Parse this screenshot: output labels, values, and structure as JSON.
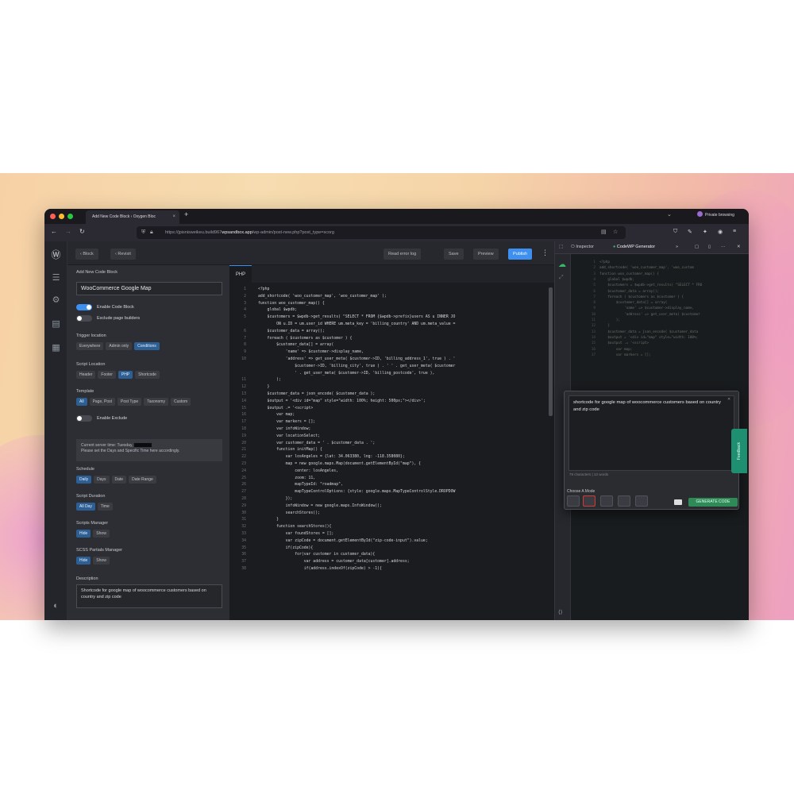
{
  "browser": {
    "tab_title": "Add New Code Block ‹ Oxygen Bloc",
    "new_tab": "+",
    "private_label": "Private browsing",
    "url_prefix": "https://jpisnisweikeu.build967",
    "url_domain": "wpsandbox.app",
    "url_path": "/wp-admin/post-new.php?post_type=scorg"
  },
  "toolbar": {
    "back_label": "‹ Block",
    "revisions_label": "‹ Revisit",
    "error_log_label": "Read error log",
    "save_label": "Save",
    "preview_label": "Preview",
    "publish_label": "Publish"
  },
  "settings": {
    "heading": "Add New Code Block",
    "title_value": "WooCommerce Google Map",
    "enable_code_block": "Enable Code Block",
    "exclude_page_builders": "Exclude page builders",
    "trigger_location_label": "Trigger location",
    "trigger_location_options": [
      "Everywhere",
      "Admin only",
      "Conditions"
    ],
    "script_location_label": "Script Location",
    "script_location_options": [
      "Header",
      "Footer",
      "PHP",
      "Shortcode"
    ],
    "template_label": "Template",
    "template_options": [
      "All",
      "Page, Post",
      "Post Type",
      "Taxonomy",
      "Custom"
    ],
    "enable_exclude": "Enable Exclude",
    "notice_line1": "Current server time: Tuesday,",
    "notice_line2": "Please set the Days and Specific Time here accordingly.",
    "schedule_label": "Schedule",
    "schedule_options": [
      "Daily",
      "Days",
      "Date",
      "Date Range"
    ],
    "script_duration_label": "Script Duration",
    "script_duration_options": [
      "All Day",
      "Time"
    ],
    "scripts_manager_label": "Scripts Manager",
    "scripts_manager_options": [
      "Hide",
      "Show"
    ],
    "scss_partials_label": "SCSS Partials Manager",
    "scss_partials_options": [
      "Hide",
      "Show"
    ],
    "description_label": "Description",
    "description_value": "Shortcode for google map of woocommerce customers based on country and zip code"
  },
  "editor": {
    "tab_label": "PHP",
    "lines": [
      {
        "n": "1",
        "t": "<?php"
      },
      {
        "n": "2",
        "t": "add_shortcode( 'woo_customer_map', 'woo_customer_map' );"
      },
      {
        "n": "3",
        "t": "function woo_customer_map() {"
      },
      {
        "n": "4",
        "t": "    global $wpdb;"
      },
      {
        "n": "5",
        "t": "    $customers = $wpdb->get_results( \"SELECT * FROM {$wpdb->prefix}users AS u INNER JO"
      },
      {
        "n": "",
        "t": "        ON u.ID = um.user_id WHERE um.meta_key = 'billing_country' AND um.meta_value ="
      },
      {
        "n": "6",
        "t": "    $customer_data = array();"
      },
      {
        "n": "7",
        "t": "    foreach ( $customers as $customer ) {"
      },
      {
        "n": "8",
        "t": "        $customer_data[] = array("
      },
      {
        "n": "9",
        "t": "            'name' => $customer->display_name,"
      },
      {
        "n": "10",
        "t": "            'address' => get_user_meta( $customer->ID, 'billing_address_1', true ) . '"
      },
      {
        "n": "",
        "t": "                $customer->ID, 'billing_city', true ) . ' ' . get_user_meta( $customer"
      },
      {
        "n": "",
        "t": "                ' . get_user_meta( $customer->ID, 'billing_postcode', true ),"
      },
      {
        "n": "11",
        "t": "        );"
      },
      {
        "n": "12",
        "t": "    }"
      },
      {
        "n": "13",
        "t": "    $customer_data = json_encode( $customer_data );"
      },
      {
        "n": "14",
        "t": "    $output = '<div id=\"map\" style=\"width: 100%; height: 500px;\"></div>';"
      },
      {
        "n": "15",
        "t": "    $output .= '<script>"
      },
      {
        "n": "16",
        "t": "        var map;"
      },
      {
        "n": "17",
        "t": "        var markers = [];"
      },
      {
        "n": "18",
        "t": "        var infoWindow;"
      },
      {
        "n": "19",
        "t": "        var locationSelect;"
      },
      {
        "n": "20",
        "t": "        var customer_data = ' . $customer_data . ';"
      },
      {
        "n": "21",
        "t": "        function initMap() {"
      },
      {
        "n": "22",
        "t": "            var losAngeles = {lat: 34.063380, lng: -118.358080};"
      },
      {
        "n": "23",
        "t": "            map = new google.maps.Map(document.getElementById(\"map\"), {"
      },
      {
        "n": "24",
        "t": "                center: losAngeles,"
      },
      {
        "n": "25",
        "t": "                zoom: 11,"
      },
      {
        "n": "26",
        "t": "                mapTypeId: \"roadmap\","
      },
      {
        "n": "27",
        "t": "                mapTypeControlOptions: {style: google.maps.MapTypeControlStyle.DROPDOW"
      },
      {
        "n": "28",
        "t": "            });"
      },
      {
        "n": "29",
        "t": "            infoWindow = new google.maps.InfoWindow();"
      },
      {
        "n": "30",
        "t": "            searchStores();"
      },
      {
        "n": "31",
        "t": "        }"
      },
      {
        "n": "32",
        "t": "        function searchStores(){"
      },
      {
        "n": "33",
        "t": "            var foundStores = [];"
      },
      {
        "n": "34",
        "t": "            var zipCode = document.getElementById(\"zip-code-input\").value;"
      },
      {
        "n": "35",
        "t": "            if(zipCode){"
      },
      {
        "n": "36",
        "t": "                for(var customer in customer_data){"
      },
      {
        "n": "37",
        "t": "                    var address = customer_data[customer].address;"
      },
      {
        "n": "38",
        "t": "                    if(address.indexOf(zipCode) > -1){"
      }
    ]
  },
  "devtools": {
    "inspector_label": "Inspector",
    "generator_label": "CodeWP Generator",
    "more_label": "»",
    "code_lines": [
      {
        "n": "1",
        "t": "<?php"
      },
      {
        "n": "2",
        "t": "add_shortcode( 'woo_customer_map', 'woo_custom"
      },
      {
        "n": "3",
        "t": "function woo_customer_map() {"
      },
      {
        "n": "4",
        "t": "    global $wpdb;"
      },
      {
        "n": "5",
        "t": "    $customers = $wpdb->get_results( \"SELECT * FRO"
      },
      {
        "n": "6",
        "t": "    $customer_data = array();"
      },
      {
        "n": "7",
        "t": "    foreach ( $customers as $customer ) {"
      },
      {
        "n": "8",
        "t": "        $customer_data[] = array("
      },
      {
        "n": "9",
        "t": "            'name' => $customer->display_name,"
      },
      {
        "n": "10",
        "t": "            'address' => get_user_meta( $customer"
      },
      {
        "n": "11",
        "t": "        );"
      },
      {
        "n": "12",
        "t": "    }"
      },
      {
        "n": "13",
        "t": "    $customer_data = json_encode( $customer_data"
      },
      {
        "n": "14",
        "t": "    $output = '<div id=\"map\" style=\"width: 100%;"
      },
      {
        "n": "15",
        "t": "    $output .= '<script>"
      },
      {
        "n": "16",
        "t": "        var map;"
      },
      {
        "n": "17",
        "t": "        var markers = [];"
      },
      {
        "n": "36",
        "t": "                for(var customer in customer_dat"
      },
      {
        "n": "37",
        "t": "                    var address = customer_data[cu"
      },
      {
        "n": "38",
        "t": "                    if(address.indexOf(zipCode) > -"
      },
      {
        "n": "39",
        "t": "                        foundStores.push(customer"
      },
      {
        "n": "40",
        "t": "                    }"
      },
      {
        "n": "41",
        "t": "                }"
      },
      {
        "n": "42",
        "t": "            } else {"
      },
      {
        "n": "43",
        "t": "                foundStores = customer_data;"
      },
      {
        "n": "44",
        "t": "            }"
      },
      {
        "n": "45",
        "t": "            clearLocations();"
      },
      {
        "n": "46",
        "t": "            displayStores(foundStores);"
      },
      {
        "n": "47",
        "t": "            showStoresMarkers(foundStores);"
      },
      {
        "n": "48",
        "t": "            setOnClickListener();"
      },
      {
        "n": "49",
        "t": "        }"
      },
      {
        "n": "50",
        "t": "        function clearLocations(){"
      },
      {
        "n": "51",
        "t": "            infoWindow.close();"
      },
      {
        "n": "52",
        "t": "            for (var i = 0; i < markers.length; i++"
      }
    ],
    "prompt_text": "shortcode for google map of woocommerce customers based on country and zip code",
    "char_count": "79 characters | 13 words",
    "choose_mode_label": "Choose A Mode",
    "generate_label": "GENERATE CODE",
    "feedback_label": "Feedback"
  },
  "colors": {
    "accent": "#3d8ff0",
    "generate": "#2e8b57",
    "feedback": "#1e8f70"
  }
}
